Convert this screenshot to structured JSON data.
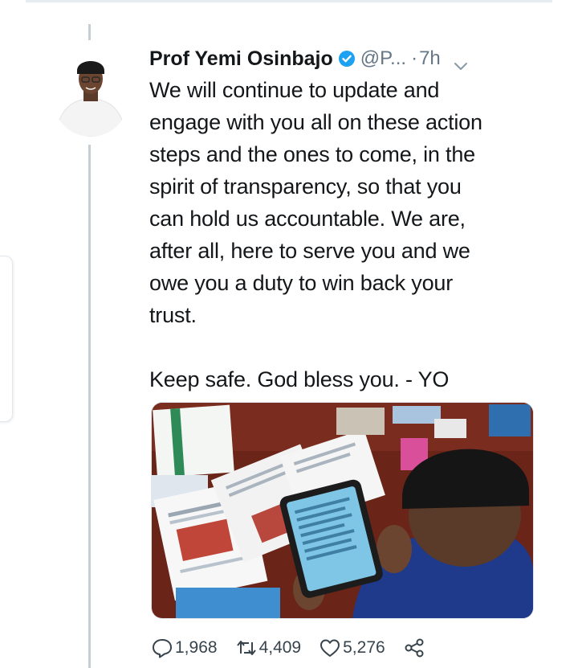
{
  "tweet": {
    "author_name": "Prof Yemi Osinbajo",
    "handle": "@P...",
    "separator": "·",
    "time": "7h",
    "text": "We will continue to update and\nengage with you all on these action\nsteps and the ones to come, in the\nspirit of transparency, so that you\ncan hold us accountable. We are,\nafter all, here to serve you and we\nowe you a duty to win back your\ntrust.\n\nKeep safe. God bless you. - YO"
  },
  "actions": {
    "replies": "1,968",
    "retweets": "4,409",
    "likes": "5,276"
  },
  "icons": {
    "verified": "verified-badge-icon",
    "menu": "chevron-down-icon",
    "reply": "reply-icon",
    "retweet": "retweet-icon",
    "like": "heart-icon",
    "share": "share-icon"
  },
  "colors": {
    "verified": "#1da1f2",
    "text": "#14171a",
    "secondary": "#657786",
    "thread_line": "#c4cfd6"
  }
}
